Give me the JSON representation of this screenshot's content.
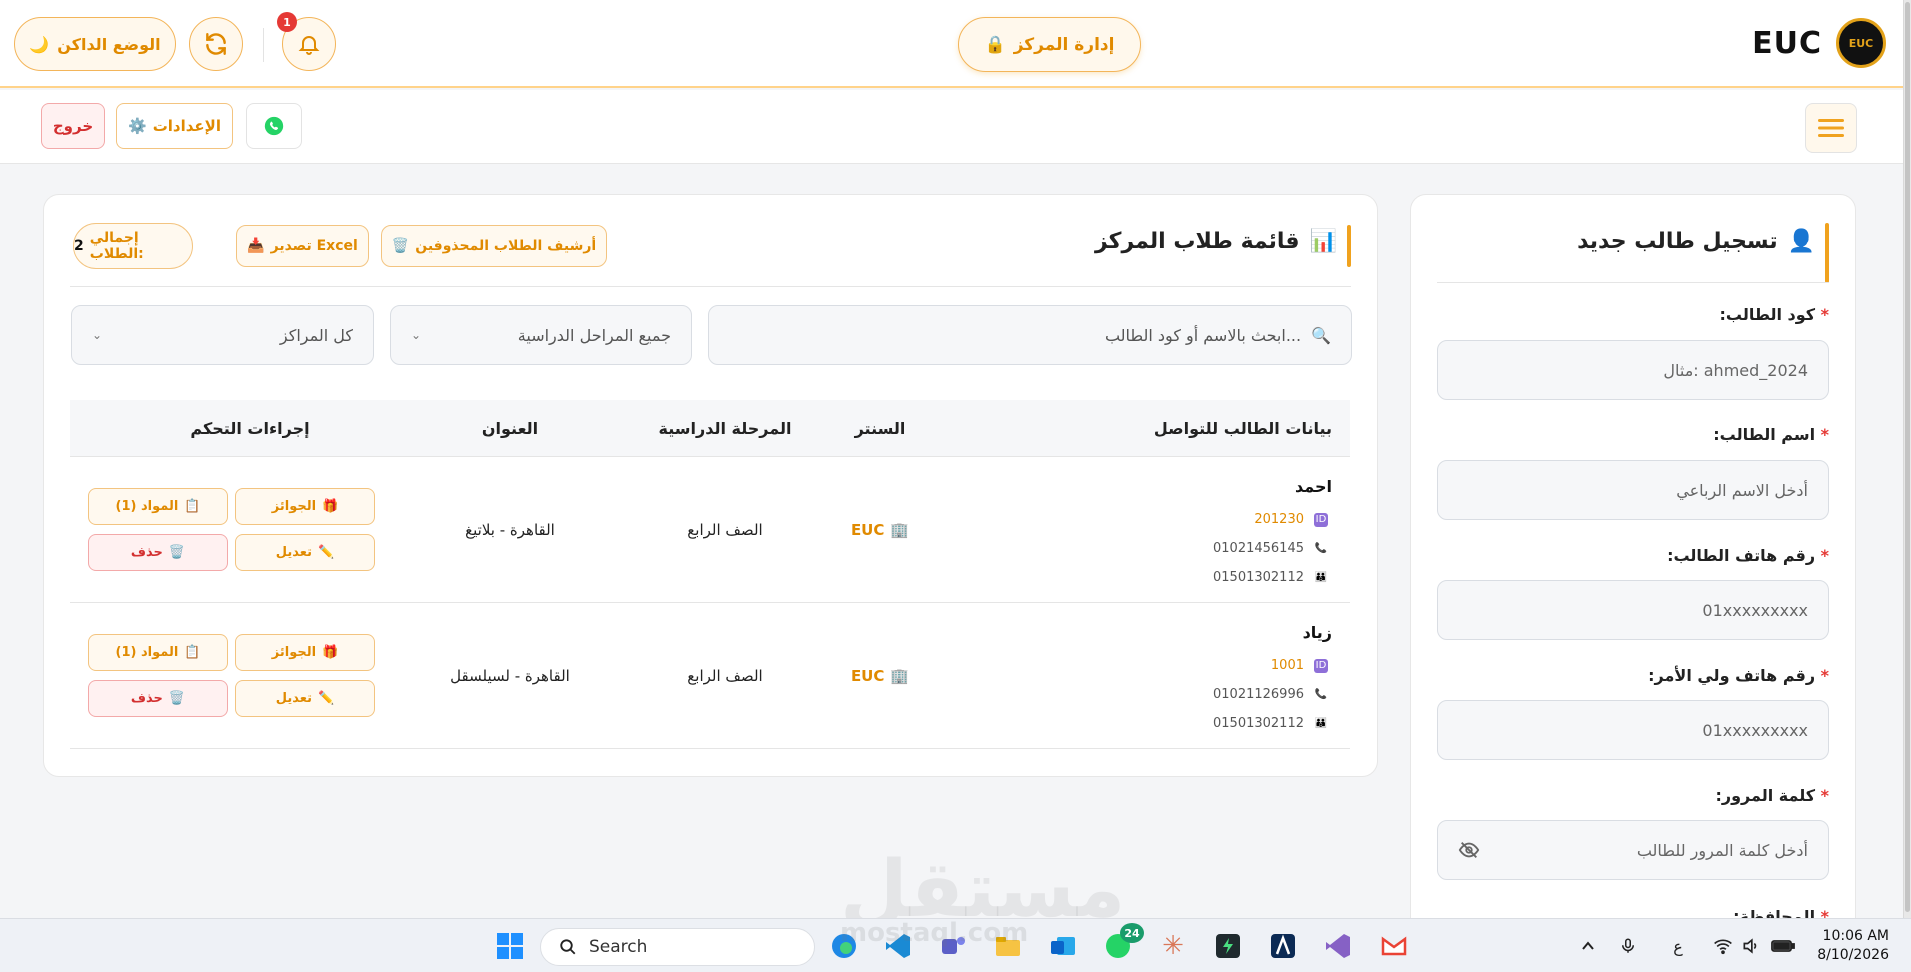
{
  "header": {
    "brand": "EUC",
    "logo_text": "EUC",
    "center_button": "إدارة المركز",
    "dark_mode_label": "الوضع الداكن",
    "notification_count": "1"
  },
  "subbar": {
    "logout": "خروج",
    "settings": "الإعدادات"
  },
  "register": {
    "title": "تسجيل طالب جديد",
    "fields": [
      {
        "label": "كود الطالب:",
        "placeholder": "مثال: ahmed_2024"
      },
      {
        "label": "اسم الطالب:",
        "placeholder": "أدخل الاسم الرباعي"
      },
      {
        "label": "رقم هاتف الطالب:",
        "placeholder": "01xxxxxxxxx"
      },
      {
        "label": "رقم هاتف ولي الأمر:",
        "placeholder": "01xxxxxxxxx"
      },
      {
        "label": "كلمة المرور:",
        "placeholder": "أدخل كلمة المرور للطالب"
      }
    ],
    "next_label": "المحافظة:",
    "required_mark": "*"
  },
  "list": {
    "title": "قائمة طلاب المركز",
    "archive": "أرشيف الطلاب المحذوفين",
    "export": "تصدير Excel",
    "total_label": "إجمالي الطلاب:",
    "total_value": "2",
    "search_placeholder": "ابحث بالاسم أو كود الطالب...",
    "stage_filter": "جميع المراحل الدراسية",
    "center_filter": "كل المراكز",
    "columns": [
      "بيانات الطالب للتواصل",
      "السنتر",
      "المرحلة الدراسية",
      "العنوان",
      "إجراءات التحكم"
    ],
    "rows": [
      {
        "name": "احمد",
        "code": "201230",
        "phone": "01021456145",
        "parent_phone": "01501302112",
        "center": "EUC",
        "stage": "الصف الرابع",
        "address": "القاهرة - بلاتيغ"
      },
      {
        "name": "زياد",
        "code": "1001",
        "phone": "01021126996",
        "parent_phone": "01501302112",
        "center": "EUC",
        "stage": "الصف الرابع",
        "address": "القاهرة - لسيلسقل"
      }
    ],
    "actions": {
      "prizes": "الجوائز",
      "subjects": "المواد (1)",
      "edit": "تعديل",
      "delete": "حذف"
    }
  },
  "watermark": {
    "arabic": "مستقل",
    "latin": "mostaql.com"
  },
  "taskbar": {
    "search": "Search",
    "whatsapp_badge": "24",
    "lang": "ع",
    "time": "10:06 AM",
    "date": "8/10/2026"
  },
  "colors": {
    "accent": "#e08a00",
    "danger": "#d32f2f",
    "whatsapp": "#25d366"
  }
}
